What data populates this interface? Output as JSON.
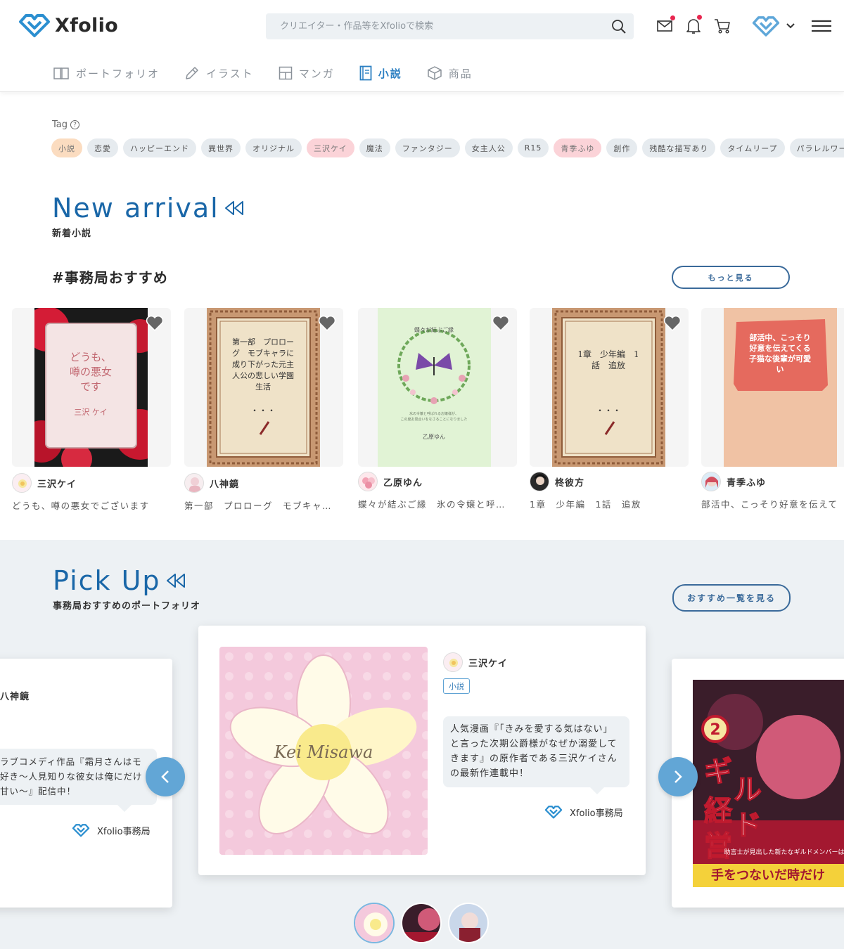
{
  "brand": {
    "name": "Xfolio"
  },
  "search": {
    "placeholder": "クリエイター・作品等をXfolioで検索"
  },
  "header_icons": [
    "mail-icon",
    "bell-icon",
    "cart-icon",
    "xfolio-menu-icon",
    "hamburger-icon"
  ],
  "nav": {
    "items": [
      {
        "label": "ポートフォリオ",
        "icon": "book-open-icon",
        "active": false
      },
      {
        "label": "イラスト",
        "icon": "pen-icon",
        "active": false
      },
      {
        "label": "マンガ",
        "icon": "grid-icon",
        "active": false
      },
      {
        "label": "小説",
        "icon": "book-icon",
        "active": true
      },
      {
        "label": "商品",
        "icon": "box-icon",
        "active": false
      }
    ]
  },
  "tags": {
    "title": "Tag",
    "items": [
      {
        "label": "小説",
        "style": "orange"
      },
      {
        "label": "恋愛",
        "style": "gray"
      },
      {
        "label": "ハッピーエンド",
        "style": "gray"
      },
      {
        "label": "異世界",
        "style": "gray"
      },
      {
        "label": "オリジナル",
        "style": "gray"
      },
      {
        "label": "三沢ケイ",
        "style": "pink"
      },
      {
        "label": "魔法",
        "style": "gray"
      },
      {
        "label": "ファンタジー",
        "style": "gray"
      },
      {
        "label": "女主人公",
        "style": "gray"
      },
      {
        "label": "R15",
        "style": "gray"
      },
      {
        "label": "青季ふゆ",
        "style": "pink"
      },
      {
        "label": "創作",
        "style": "gray"
      },
      {
        "label": "残酷な描写あり",
        "style": "gray"
      },
      {
        "label": "タイムリープ",
        "style": "gray"
      },
      {
        "label": "パラレルワールド",
        "style": "gray"
      }
    ]
  },
  "new_arrival": {
    "title": "New arrival",
    "subtitle": "新着小説",
    "section_label": "#事務局おすすめ",
    "more_label": "もっと見る",
    "cards": [
      {
        "cover_text": "どうも、噂の悪女です",
        "cover_author": "三沢 ケイ",
        "author": "三沢ケイ",
        "desc": "どうも、噂の悪女でございます"
      },
      {
        "cover_text": "第一部 プロローグ モブキャラに成り下がった元主人公の悲しい学園生活",
        "cover_author": "",
        "author": "八神鏡",
        "desc": "第一部　プロローグ　モブキャ…"
      },
      {
        "cover_text": "蝶々が結ぶご縁",
        "cover_sub": "氷の令嬢と呼ばれるお嬢様が、この度お見合いをなさることになりました",
        "cover_author": "乙原ゆん",
        "author": "乙原ゆん",
        "desc": "蝶々が結ぶご縁　氷の令嬢と呼…"
      },
      {
        "cover_text": "1章 少年編 1話 追放",
        "cover_author": "",
        "author": "柊彼方",
        "desc": "1章　少年編　1話　追放"
      },
      {
        "cover_text": "部活中、こっそり好意を伝えてくる子猫な後輩が可愛い",
        "cover_author": "",
        "author": "青季ふゆ",
        "desc": "部活中、こっそり好意を伝えて"
      }
    ]
  },
  "pick_up": {
    "title": "Pick Up",
    "subtitle": "事務局おすすめのポートフォリオ",
    "more_label": "おすすめ一覧を見る",
    "left_card": {
      "author": "八神鏡",
      "bubble": "ラブコメディ作品『霜月さんはモ好き～人見知りな彼女は俺にだけ甘い～』配信中！",
      "bubble_lines": [
        "ラブコメディ作品『霜月さんはモ",
        "好き～人見知りな彼女は俺にだけ",
        "甘い～』配信中！"
      ],
      "office": "Xfolio事務局"
    },
    "center_card": {
      "image_text": "Kei Misawa",
      "author": "三沢ケイ",
      "badge": "小説",
      "bubble": "人気漫画『「きみを愛する気はない」と言った次期公爵様がなぜか溺愛してきます』の原作者である三沢ケイさんの最新作連載中！",
      "bubble_lines": [
        "人気漫画『「きみを愛する気はない」",
        "と言った次期公爵様がなぜか溺愛して",
        "きます』の原作者である三沢ケイさん",
        "の最新作連載中！"
      ],
      "office": "Xfolio事務局"
    },
    "right_card": {
      "cover_text": "ギルド経営",
      "cover_badge": "2",
      "cover_sub": "助言士が見出した新たなギルドメンバーは",
      "cover_bottom": "手をつないだ時だけ"
    }
  },
  "colors": {
    "accent": "#1a67a8",
    "active_nav": "#2b7fc2",
    "nav_btn": "#62a6d6",
    "pick_bg": "#edf1f4"
  }
}
